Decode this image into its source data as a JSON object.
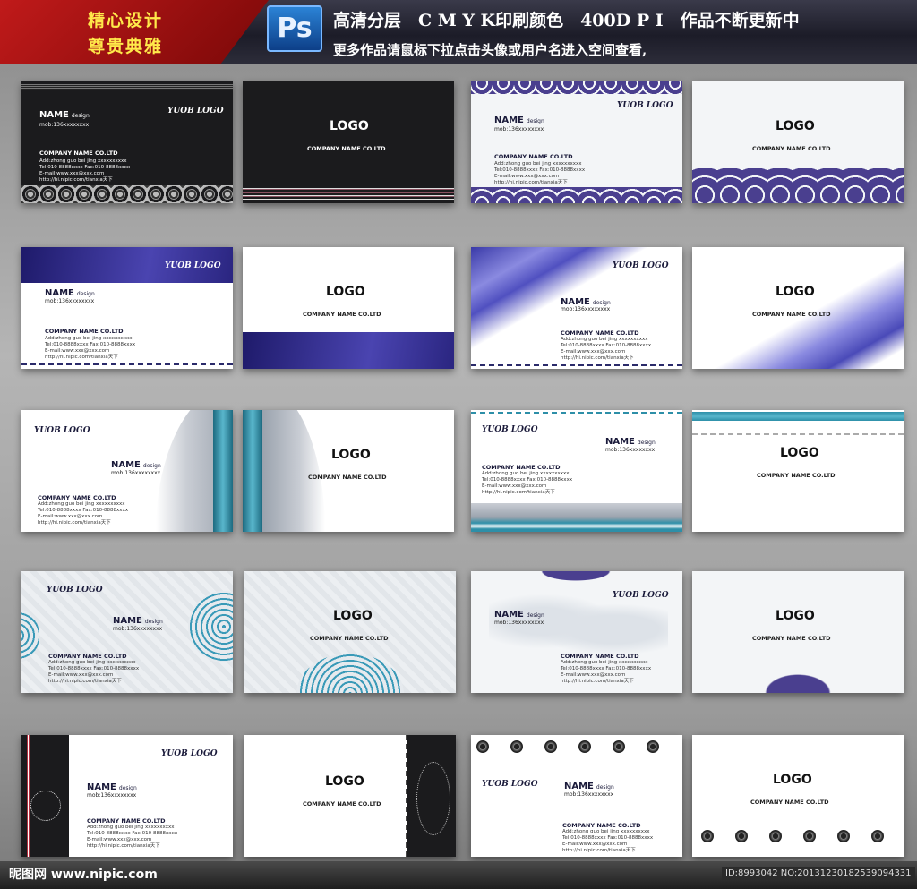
{
  "header": {
    "badge_line1": "精心设计",
    "badge_line2": "尊贵典雅",
    "ps_label": "Ps",
    "title": "高清分层　C M Y K印刷颜色　400D P I　作品不断更新中",
    "subtitle": "更多作品请鼠标下拉点击头像或用户名进入空间查看,"
  },
  "card_text": {
    "logo_script": "YUOB LOGO",
    "logo": "LOGO",
    "company_center": "COMPANY NAME CO.LTD",
    "name": "NAME",
    "design": "design",
    "mob": "mob:136xxxxxxxx",
    "company": "COMPANY NAME CO.LTD",
    "address": "Add:zhong guo bei jing xxxxxxxxxx",
    "tel": "Tel:010-8888xxxx Fax:010-8888xxxx",
    "email": "E-mail:www.xxx@xxx.com",
    "web": "http://hi.nipic.com/tianxia天下"
  },
  "footer": {
    "site": "昵图网 www.nipic.com",
    "id": "ID:8993042 NO:20131230182539094331"
  },
  "colors": {
    "navy": "#2a2a6a",
    "purple": "#4a3f8f",
    "teal": "#2d8fa8",
    "dark_card": "#1b1b1d"
  }
}
